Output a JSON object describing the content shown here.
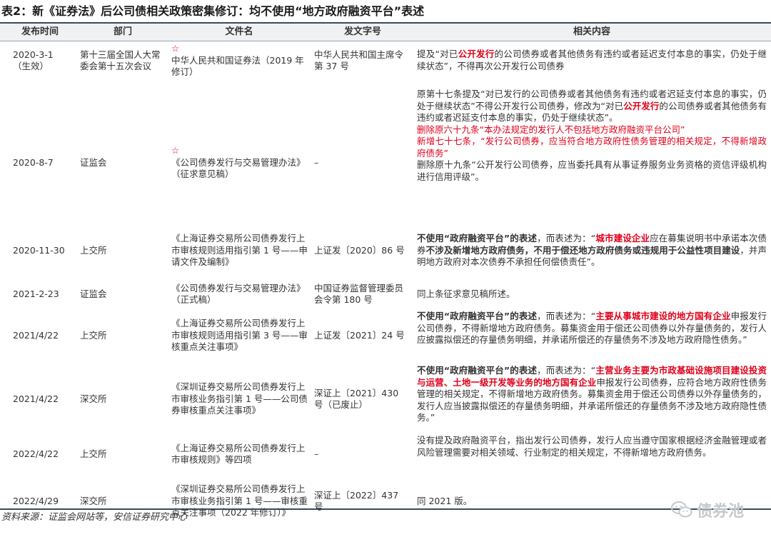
{
  "title": "表2：新《证券法》后公司债相关政策密集修订：均不使用“地方政府融资平台”表述",
  "headers": [
    "发布时间",
    "部门",
    "文件名",
    "发文字号",
    "相关内容"
  ],
  "rows": [
    {
      "date": "2020-3-1\n（生效）",
      "dept": "第十三届全国人大常委会第十五次会议",
      "doc_star": "☆",
      "doc": "中华人民共和国证券法（2019 年修订）",
      "num": "中华人民共和国主席令第 37 号",
      "content_parts": [
        "提及“对已",
        "公开发行",
        "的公司债券或者其他债务有违约或者延迟支付本息的事实，仍处于继续状态”，不得再次公开发行公司债券"
      ]
    },
    {
      "date": "2020-8-7",
      "dept": "证监会",
      "doc_star": "☆",
      "doc": "《公司债券发行与交易管理办法》（征求意见稿）",
      "num": "–",
      "content_p1": [
        "原第十七条提及“对已发行的公司债券或者其他债务有违约或者迟延支付本息的事实，仍处于继续状态”不得公开发行公司债券，修改为“对已",
        "公开发行",
        "的公司债券或者其他债务有违约或者迟延支付本息的事实，仍处于继续状态”。"
      ],
      "content_p2": "删除原六十九条“本办法规定的发行人不包括地方政府融资平台公司”",
      "content_p3": "新增七十七条，“发行公司债券，应当符合地方政府性债务管理的相关规定，不得新增政府债务”",
      "content_p4": "删除原十九条“公开发行公司债券，应当委托具有从事证券服务业务资格的资信评级机构进行信用评级”。"
    },
    {
      "date": "2020-11-30",
      "dept": "上交所",
      "doc": "《上海证券交易所公司债券发行上市审核规则适用指引第 1 号——申请文件及编制》",
      "num": "上证发〔2020〕86 号",
      "content_parts": [
        "不使用“政府融资平台”的表述",
        "，而表述为：“",
        "城市建设企业",
        "应在募集说明书中承诺本次债券",
        "不涉及新增地方政府债务，不用于偿还地方政府债务或违规用于公益性项目建设",
        "，并声明地方政府对本次债券不承担任何偿债责任”。"
      ]
    },
    {
      "date": "2021-2-23",
      "dept": "证监会",
      "doc": "《公司债券发行与交易管理办法》（正式稿）",
      "num": "中国证券监督管理委员会令第 180 号",
      "content": "同上条征求意见稿所述。"
    },
    {
      "date": "2021/4/22",
      "dept": "上交所",
      "doc": "《上海证券交易所公司债券发行上市审核规则适用指引第 3 号——审核重点关注事项》",
      "num": "上证发〔2021〕24 号",
      "content_parts": [
        "不使用“政府融资平台”的表述",
        "，而表述为：“",
        "主要从事城市建设的地方国有企业",
        "申报发行公司债券，不得新增地方政府债务。募集资金用于偿还公司债券以外存量债务的，发行人应披露拟偿还的存量债务明细，并承诺所偿还的存量债务不涉及地方政府隐性债务。”"
      ]
    },
    {
      "date": "2021/4/22",
      "dept": "深交所",
      "doc": "《深圳证券交易所公司债券发行上市审核业务指引第 1 号——公司债券审核重点关注事项》",
      "num": "深证上〔2021〕430 号（已废止）",
      "content_parts": [
        "不使用“政府融资平台”的表述",
        "，而表述为：“",
        "主营业务主要为市政基础设施项目建设投资与运营、土地一级开发等业务的地方国有企业",
        "申报发行公司债券，应符合地方政府性债务管理的相关规定，不得新增地方政府债务。募集资金用于偿还公司债券以外存量债务的，发行人应当披露拟偿还的存量债务明细，并承诺所偿还的存量债务不涉及地方政府隐性债务。”"
      ]
    },
    {
      "date": "2022/4/22",
      "dept": "上交所",
      "doc": "《上海证券交易所公司债券发行上市审核规则》等四项",
      "num": "–",
      "content": "没有提及政府融资平台，指出发行公司债券，发行人应当遵守国家根据经济金融管理或者风险管理需要对相关领域、行业制定的相关规定，不得新增地方政府债务。"
    },
    {
      "date": "2022/4/29",
      "dept": "深交所",
      "doc": "《深圳证券交易所公司债券发行上市审核业务指引第 1 号——审核重点关注事项（2022 年修订）》",
      "num": "深证上〔2022〕437 号",
      "content": "同 2021 版。"
    }
  ],
  "source": "资料来源：证监会网站等，安信证券研究中心",
  "watermark": "债券池",
  "watermark_icon": "wechat-icon",
  "colors": {
    "highlight": "#e0001a",
    "rule": "#3a4a5e",
    "header_bg": "#f0f1f3"
  }
}
